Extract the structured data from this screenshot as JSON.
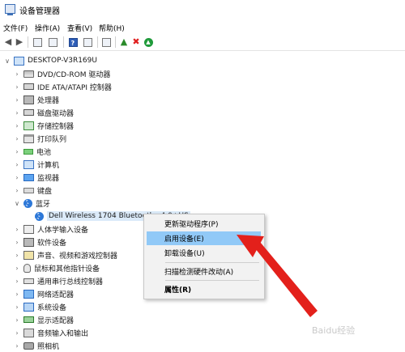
{
  "window": {
    "title": "设备管理器",
    "app_icon": "device-manager-icon"
  },
  "menubar": [
    {
      "label": "文件(F)"
    },
    {
      "label": "操作(A)"
    },
    {
      "label": "查看(V)"
    },
    {
      "label": "帮助(H)"
    }
  ],
  "toolbar": {
    "buttons": [
      "back-icon",
      "forward-icon",
      "properties-icon",
      "show-hidden-icon",
      "help-icon",
      "scan-icon",
      "monitor-icon",
      "update-driver-icon",
      "uninstall-icon",
      "enable-icon"
    ],
    "colors": {
      "uninstall": "#e02020",
      "enable": "#1f9a3a"
    }
  },
  "tree": {
    "root": "DESKTOP-V3R169U",
    "categories": [
      {
        "label": "DVD/CD-ROM 驱动器",
        "icon": "disk-drive-icon"
      },
      {
        "label": "IDE ATA/ATAPI 控制器",
        "icon": "ide-controller-icon"
      },
      {
        "label": "处理器",
        "icon": "processor-icon"
      },
      {
        "label": "磁盘驱动器",
        "icon": "hard-drive-icon"
      },
      {
        "label": "存储控制器",
        "icon": "storage-controller-icon"
      },
      {
        "label": "打印队列",
        "icon": "printer-icon"
      },
      {
        "label": "电池",
        "icon": "battery-icon"
      },
      {
        "label": "计算机",
        "icon": "computer-icon"
      },
      {
        "label": "监视器",
        "icon": "monitor-icon"
      },
      {
        "label": "键盘",
        "icon": "keyboard-icon"
      },
      {
        "label": "蓝牙",
        "icon": "bluetooth-icon",
        "expanded": true
      },
      {
        "label": "人体学输入设备",
        "icon": "hid-icon"
      },
      {
        "label": "软件设备",
        "icon": "software-device-icon"
      },
      {
        "label": "声音、视频和游戏控制器",
        "icon": "sound-icon"
      },
      {
        "label": "鼠标和其他指针设备",
        "icon": "mouse-icon"
      },
      {
        "label": "通用串行总线控制器",
        "icon": "usb-icon"
      },
      {
        "label": "网络适配器",
        "icon": "network-icon"
      },
      {
        "label": "系统设备",
        "icon": "system-device-icon"
      },
      {
        "label": "显示适配器",
        "icon": "display-adapter-icon"
      },
      {
        "label": "音频输入和输出",
        "icon": "audio-io-icon"
      },
      {
        "label": "照相机",
        "icon": "camera-icon"
      }
    ],
    "bluetooth_child": "Dell Wireless 1704 Bluetooth v4.0+HS"
  },
  "context_menu": {
    "items": [
      {
        "label": "更新驱动程序(P)"
      },
      {
        "label": "启用设备(E)",
        "highlighted": true
      },
      {
        "label": "卸载设备(U)"
      },
      {
        "label": "扫描检测硬件改动(A)"
      },
      {
        "label": "属性(R)",
        "bold": true
      }
    ],
    "highlight_color": "#91c9f7"
  },
  "annotation": {
    "arrow_color": "#e3201b"
  },
  "watermark": "Baidu经验"
}
